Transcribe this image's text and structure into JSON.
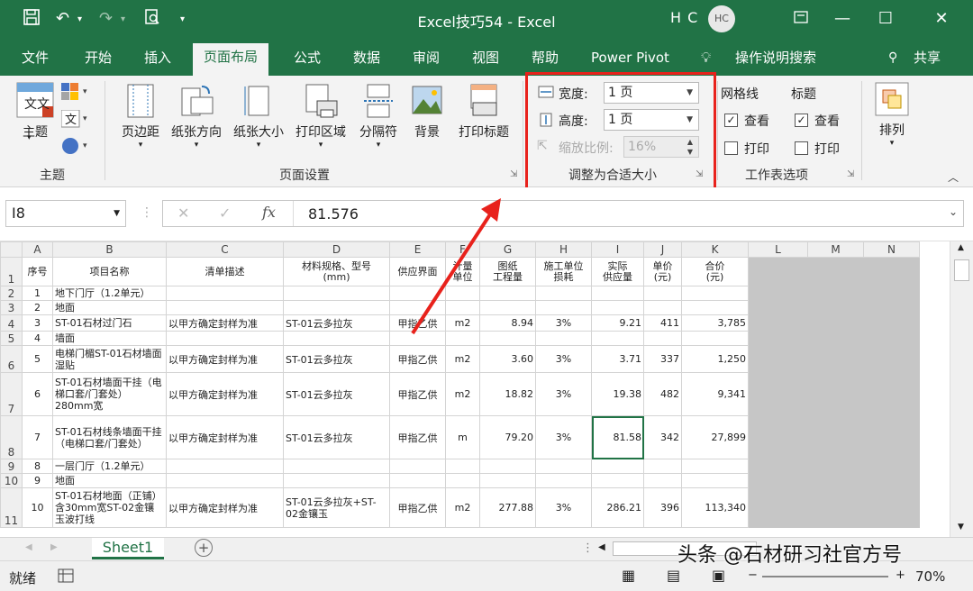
{
  "window": {
    "title": "Excel技巧54  -  Excel",
    "user_initials": "H C",
    "avatar_text": "HC"
  },
  "tabs": [
    "文件",
    "开始",
    "插入",
    "页面布局",
    "公式",
    "数据",
    "审阅",
    "视图",
    "帮助",
    "Power Pivot",
    "操作说明搜索",
    "共享"
  ],
  "active_tab": "页面布局",
  "ribbon": {
    "theme_group": {
      "label": "主题",
      "button": "主题",
      "icon_text": "文"
    },
    "page_setup_group": {
      "label": "页面设置",
      "buttons": [
        "页边距",
        "纸张方向",
        "纸张大小",
        "打印区域",
        "分隔符",
        "背景",
        "打印标题"
      ]
    },
    "scale_group": {
      "label": "调整为合适大小",
      "width_label": "宽度:",
      "width_value": "1 页",
      "height_label": "高度:",
      "height_value": "1 页",
      "scale_label": "缩放比例:",
      "scale_value": "16%"
    },
    "sheet_options_group": {
      "label": "工作表选项",
      "gridlines": "网格线",
      "headings": "标题",
      "view": "查看",
      "print": "打印"
    },
    "arrange_group": {
      "button": "排列"
    }
  },
  "formula_bar": {
    "name_box": "I8",
    "fx": "fx",
    "value": "81.576"
  },
  "sheet": {
    "columns": [
      "A",
      "B",
      "C",
      "D",
      "E",
      "F",
      "G",
      "H",
      "I",
      "J",
      "K",
      "L",
      "M",
      "N"
    ],
    "header_row": [
      "序号",
      "项目名称",
      "清单描述",
      "材料规格、型号\n(mm)",
      "供应界面",
      "计量\n单位",
      "图纸\n工程量",
      "施工单位\n损耗",
      "实际\n供应量",
      "单价\n(元)",
      "合价\n(元)"
    ],
    "rows": [
      {
        "num": "2",
        "cells": [
          "1",
          "地下门厅（1.2单元）",
          "",
          "",
          "",
          "",
          "",
          "",
          "",
          "",
          ""
        ]
      },
      {
        "num": "3",
        "cells": [
          "2",
          "地面",
          "",
          "",
          "",
          "",
          "",
          "",
          "",
          "",
          ""
        ]
      },
      {
        "num": "4",
        "cells": [
          "3",
          "ST-01石材过门石",
          "以甲方确定封样为准",
          "ST-01云多拉灰",
          "甲指乙供",
          "m2",
          "8.94",
          "3%",
          "9.21",
          "411",
          "3,785"
        ]
      },
      {
        "num": "5",
        "cells": [
          "4",
          "墙面",
          "",
          "",
          "",
          "",
          "",
          "",
          "",
          "",
          ""
        ]
      },
      {
        "num": "6",
        "cells": [
          "5",
          "电梯门楣ST-01石材墙面湿贴",
          "以甲方确定封样为准",
          "ST-01云多拉灰",
          "甲指乙供",
          "m2",
          "3.60",
          "3%",
          "3.71",
          "337",
          "1,250"
        ]
      },
      {
        "num": "7",
        "cells": [
          "6",
          "ST-01石材墙面干挂（电梯口套/门套处）280mm宽",
          "以甲方确定封样为准",
          "ST-01云多拉灰",
          "甲指乙供",
          "m2",
          "18.82",
          "3%",
          "19.38",
          "482",
          "9,341"
        ]
      },
      {
        "num": "8",
        "cells": [
          "7",
          "ST-01石材线条墙面干挂（电梯口套/门套处）",
          "以甲方确定封样为准",
          "ST-01云多拉灰",
          "甲指乙供",
          "m",
          "79.20",
          "3%",
          "81.58",
          "342",
          "27,899"
        ]
      },
      {
        "num": "9",
        "cells": [
          "8",
          "一层门厅（1.2单元）",
          "",
          "",
          "",
          "",
          "",
          "",
          "",
          "",
          ""
        ]
      },
      {
        "num": "10",
        "cells": [
          "9",
          "地面",
          "",
          "",
          "",
          "",
          "",
          "",
          "",
          "",
          ""
        ]
      },
      {
        "num": "11",
        "cells": [
          "10",
          "ST-01石材地面（正铺）含30mm宽ST-02金镶玉波打线",
          "以甲方确定封样为准",
          "ST-01云多拉灰+ST-02金镶玉",
          "甲指乙供",
          "m2",
          "277.88",
          "3%",
          "286.21",
          "396",
          "113,340"
        ]
      }
    ]
  },
  "sheet_tabs": {
    "active": "Sheet1",
    "add": "+"
  },
  "status": {
    "ready": "就绪",
    "zoom": "70%"
  },
  "watermark": "头条 @石材研习社官方号",
  "colors": {
    "excel_green": "#217346",
    "highlight_red": "#e8221c"
  }
}
